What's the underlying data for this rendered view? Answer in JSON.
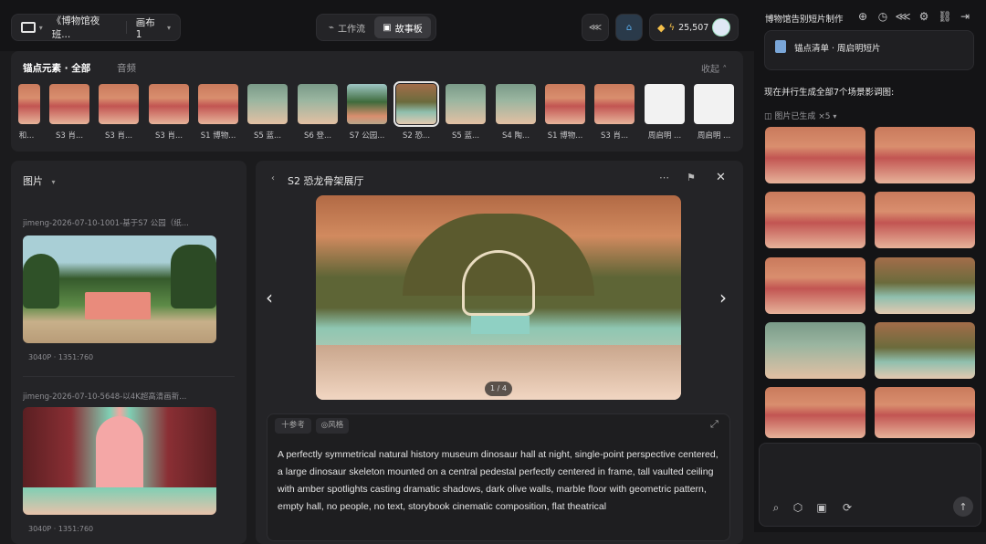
{
  "header": {
    "project_title": "《博物馆夜班...",
    "canvas_label": "画布 1",
    "mode_tabs": [
      {
        "label": "工作流",
        "active": false
      },
      {
        "label": "故事板",
        "active": true
      }
    ],
    "credits": "25,507"
  },
  "elements_bar": {
    "tab_all": "锚点元素 · 全部",
    "tab_audio": "音频",
    "collapse": "收起",
    "items": [
      {
        "label": "S3 肖...",
        "scene": "hall"
      },
      {
        "label": "S3 肖...",
        "scene": "hall"
      },
      {
        "label": "S3 肖...",
        "scene": "hall"
      },
      {
        "label": "S1 博物...",
        "scene": "hall"
      },
      {
        "label": "S5 蓝...",
        "scene": "green"
      },
      {
        "label": "S6 登...",
        "scene": "green"
      },
      {
        "label": "S7 公园...",
        "scene": "park"
      },
      {
        "label": "S2 恐...",
        "scene": "dino"
      },
      {
        "label": "S5 蓝...",
        "scene": "green"
      },
      {
        "label": "S4 陶...",
        "scene": "green"
      },
      {
        "label": "S1 博物...",
        "scene": "hall"
      },
      {
        "label": "S3 肖...",
        "scene": "hall"
      },
      {
        "label": "周启明 ...",
        "scene": "man"
      },
      {
        "label": "周启明 ...",
        "scene": "man"
      }
    ],
    "first_partial_label": "和..."
  },
  "left_panel": {
    "title": "图片",
    "images": [
      {
        "name": "jimeng-2026-07-10-1001-基于S7 公园（纸...",
        "meta": "3040P · 1351:760"
      },
      {
        "name": "jimeng-2026-07-10-5648-以4K超高清画新...",
        "meta": "3040P · 1351:760"
      }
    ]
  },
  "detail": {
    "title": "S2 恐龙骨架展厅",
    "pager": "1 / 4",
    "ref_label": "十参考",
    "style_label": "风格",
    "prompt": "A perfectly symmetrical natural history museum dinosaur hall at night, single-point perspective centered, a large dinosaur skeleton mounted on a central pedestal perfectly centered in frame, tall vaulted ceiling with amber spotlights casting dramatic shadows, dark olive walls, marble floor with geometric pattern, empty hall, no people, no text, storybook cinematic composition, flat theatrical"
  },
  "chat": {
    "title": "博物馆告别短片制作",
    "doc_card": "锚点清单 · 周启明短片",
    "message": "现在并行生成全部7个场景影调图:",
    "status": "图片已生成 ×5"
  },
  "colors": {
    "bg": "#1b1b1d",
    "panel": "#242427",
    "accent": "#f5c04a"
  }
}
